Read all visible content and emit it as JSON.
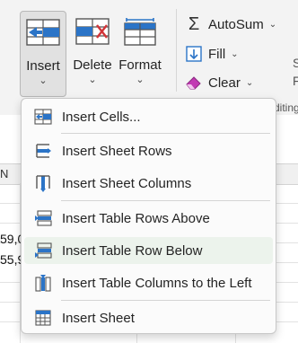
{
  "ribbon": {
    "insert": {
      "label": "Insert",
      "icon": "insert-cells-icon"
    },
    "delete": {
      "label": "Delete",
      "icon": "delete-cells-icon"
    },
    "format": {
      "label": "Format",
      "icon": "format-cells-icon"
    },
    "autosum": {
      "label": "AutoSum",
      "icon": "sigma-icon"
    },
    "fill": {
      "label": "Fill",
      "icon": "fill-down-icon"
    },
    "clear": {
      "label": "Clear",
      "icon": "eraser-icon"
    },
    "editing_group_label": "diting",
    "right_edge_s": "S",
    "right_edge_f": "F"
  },
  "sheet": {
    "column_letter": "N",
    "cell_values": [
      "59,0",
      "55,9"
    ]
  },
  "menu": {
    "items": [
      {
        "label": "Insert Cells...",
        "icon": "insert-cells-icon"
      },
      {
        "label": "Insert Sheet Rows",
        "icon": "insert-sheet-rows-icon"
      },
      {
        "label": "Insert Sheet Columns",
        "icon": "insert-sheet-columns-icon"
      },
      {
        "label": "Insert Table Rows Above",
        "icon": "insert-table-rows-above-icon"
      },
      {
        "label": "Insert Table Row Below",
        "icon": "insert-table-row-below-icon"
      },
      {
        "label": "Insert Table Columns to the Left",
        "icon": "insert-table-columns-left-icon"
      },
      {
        "label": "Insert Sheet",
        "icon": "insert-sheet-icon"
      }
    ],
    "highlighted_index": 4
  },
  "colors": {
    "accent_blue": "#2b74c7",
    "delete_red": "#d13438",
    "clear_pink": "#c239b3",
    "hover_green": "#ecf3ec"
  }
}
